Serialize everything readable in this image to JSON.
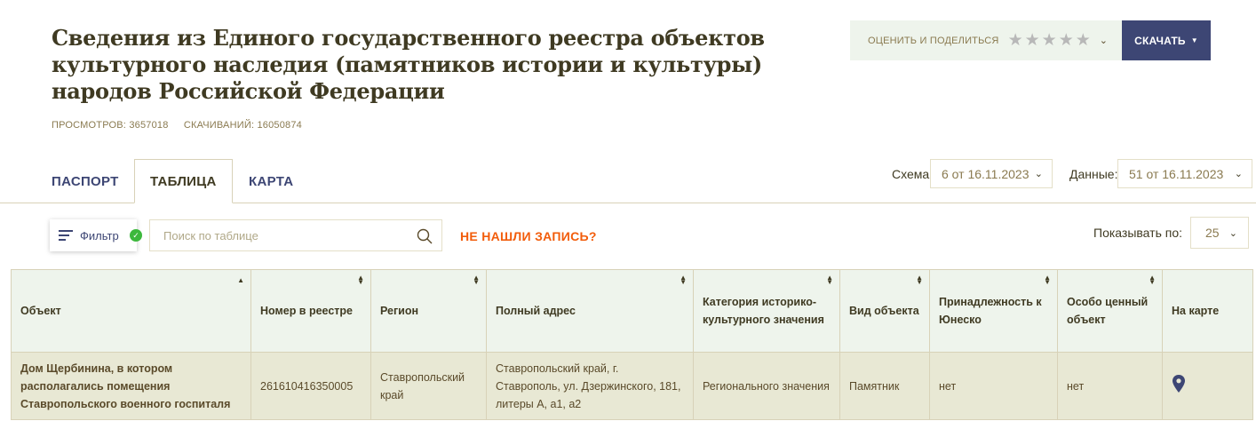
{
  "header": {
    "title": "Сведения из Единого государственного реестра объектов культурного наследия (памятников истории и культуры) народов Российской Федерации",
    "views": "ПРОСМОТРОВ: 3657018",
    "downloads": "СКАЧИВАНИЙ: 16050874",
    "rate_label": "ОЦЕНИТЬ И ПОДЕЛИТЬСЯ",
    "rating_filled_stars": 0,
    "download_label": "СКАЧАТЬ"
  },
  "tabs": [
    {
      "label": "ПАСПОРТ"
    },
    {
      "label": "ТАБЛИЦА"
    },
    {
      "label": "КАРТА"
    }
  ],
  "schema": {
    "label": "Схема:",
    "value": "6 от 16.11.2023"
  },
  "data_version": {
    "label": "Данные:",
    "value": "51 от 16.11.2023"
  },
  "toolbar": {
    "filter_label": "Фильтр",
    "search_placeholder": "Поиск по таблице",
    "not_found_label": "НЕ НАШЛИ ЗАПИСЬ?",
    "per_page_label": "Показывать по:",
    "per_page_value": "25"
  },
  "table": {
    "columns": [
      "Объект",
      "Номер в реестре",
      "Регион",
      "Полный адрес",
      "Категория историко-культурного значения",
      "Вид объекта",
      "Принадлежность к Юнеско",
      "Особо ценный объект",
      "На карте"
    ],
    "rows": [
      {
        "object": "Дом Щербинина, в котором располагались помещения Ставропольского военного госпиталя",
        "number": "261610416350005",
        "region": "Ставропольский край",
        "address": "Ставропольский край, г. Ставрополь, ул. Дзержинского, 181, литеры А, а1, а2",
        "category": "Регионального значения",
        "kind": "Памятник",
        "unesco": "нет",
        "valuable": "нет"
      }
    ]
  },
  "colors": {
    "primary": "#3d4674",
    "accent": "#f25c0a",
    "header_bg": "#eef4ec",
    "row_bg": "#e8e8d4",
    "success": "#3cb83c"
  }
}
